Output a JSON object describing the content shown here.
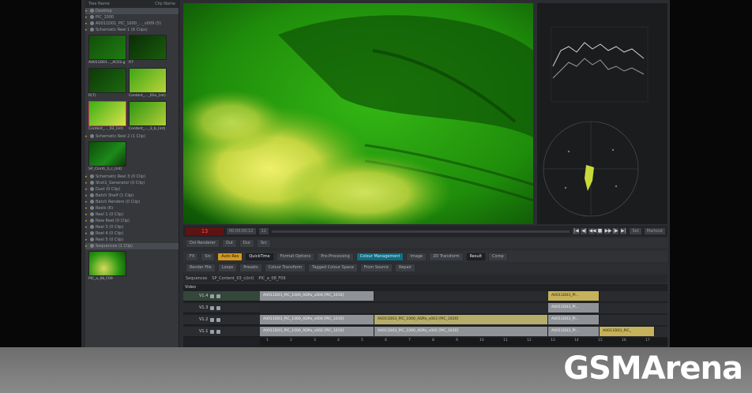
{
  "bin": {
    "header_left": "Tree Name",
    "header_right": "Clip Name",
    "rows": [
      {
        "label": "Desktop",
        "selected": true
      },
      {
        "label": "PIC_1000"
      },
      {
        "label": "A0011D01_PIC_1000_..._v009 (5)"
      },
      {
        "label": "Schematic Reel 1 (6 Clips)"
      }
    ],
    "thumbs1": [
      {
        "caption": "A0011D01..._ACES.g"
      },
      {
        "caption": "R7"
      },
      {
        "caption": "R(7)"
      },
      {
        "caption": "Content_..._01e_(int)"
      },
      {
        "caption": "Content_..._03_(int)",
        "selected": true
      },
      {
        "caption": "Content_..._3_b_(int)"
      }
    ],
    "rows2": [
      {
        "label": "Schematic Reel 2 (1 Clip)"
      }
    ],
    "thumb_single": {
      "caption": "SP_Cinnti_3_c_(int)"
    },
    "rows3": [
      {
        "label": "Schematic Reel 3 (0 Clip)"
      },
      {
        "label": "Shot1_Generator (0 Clip)"
      },
      {
        "label": "Dust (0 Clip)"
      },
      {
        "label": "Batch Shelf (1 Clip)"
      },
      {
        "label": "Batch Renders (0 Clip)"
      },
      {
        "label": "Reels (6)"
      },
      {
        "label": "Reel 1 (0 Clip)"
      },
      {
        "label": "New Reel (0 Clip)"
      },
      {
        "label": "Reel 3 (0 Clip)"
      },
      {
        "label": "Reel 4 (0 Clip)"
      },
      {
        "label": "Reel 5 (0 Clip)"
      },
      {
        "label": "Sequences (1 Clip)",
        "selected": true
      }
    ],
    "thumb_bottom": {
      "caption": "PIC_a_08_F09"
    }
  },
  "transport": {
    "timecode": "13",
    "position_label": "00:00:00:12",
    "frame_field": "12",
    "set_label": "Set",
    "mark_label": "Markout",
    "controls": [
      "|◀",
      "◀|",
      "◀◀",
      "■",
      "▶▶",
      "|▶",
      "▶|"
    ]
  },
  "bar2": {
    "items": [
      "Dst Renderer",
      "Out",
      "Dur",
      "Src"
    ]
  },
  "bar3": {
    "items": [
      {
        "label": "FX",
        "style": ""
      },
      {
        "label": "Src",
        "style": ""
      },
      {
        "label": "Auto Res",
        "style": "orange"
      },
      {
        "label": "QuickTime",
        "style": "dark"
      },
      {
        "label": "Format Options",
        "style": ""
      },
      {
        "label": "Pre-Processing",
        "style": ""
      },
      {
        "label": "Colour Management",
        "style": "teal"
      },
      {
        "label": "Image",
        "style": ""
      },
      {
        "label": "2D Transform",
        "style": ""
      },
      {
        "label": "Result",
        "style": "dark"
      },
      {
        "label": "Comp",
        "style": ""
      }
    ]
  },
  "bar4": {
    "items": [
      "Render File",
      "Loops",
      "Presets",
      "Colour Transform",
      "Tagged Colour Space",
      "From Source",
      "Repair"
    ]
  },
  "bar5": {
    "items": [
      "Sequences",
      "SP_Content_03_c(int)",
      "PIC_a_08_F09"
    ]
  },
  "timeline": {
    "section_label": "Video",
    "tracks": [
      {
        "label": "V1.4",
        "active": true
      },
      {
        "label": "V1.3"
      },
      {
        "label": "V1.2"
      },
      {
        "label": "V1.1"
      }
    ],
    "clips": [
      {
        "text": "A0011D03_PIC_1000_ADPa_v004 [PIC_1010]",
        "track": 0,
        "start": 0.0,
        "end": 0.29,
        "style": "grey"
      },
      {
        "text": "A0011D03_PI...",
        "track": 0,
        "start": 0.73,
        "end": 0.86,
        "style": "gold"
      },
      {
        "text": "A0011D03_PI...",
        "track": 1,
        "start": 0.73,
        "end": 0.86,
        "style": "grey"
      },
      {
        "text": "A0011D03_PIC_1000_ADPa_v004 [PIC_1010]",
        "track": 2,
        "start": 0.0,
        "end": 0.29,
        "style": "grey"
      },
      {
        "text": "A0011D03_PIC_1000_ADPa_v003 [PIC_1020]",
        "track": 2,
        "start": 0.29,
        "end": 0.73,
        "style": "khaki"
      },
      {
        "text": "A0011D03_PI...",
        "track": 2,
        "start": 0.73,
        "end": 0.86,
        "style": "grey"
      },
      {
        "text": "A0011D03_PIC_1000_ADPa_v002 [PIC_1010]",
        "track": 3,
        "start": 0.0,
        "end": 0.29,
        "style": "grey"
      },
      {
        "text": "A0011D03_PIC_1000_ADPa_v002 [PIC_1020]",
        "track": 3,
        "start": 0.29,
        "end": 0.73,
        "style": "grey"
      },
      {
        "text": "A0011D03_PI...",
        "track": 3,
        "start": 0.73,
        "end": 0.86,
        "style": "grey"
      },
      {
        "text": "A0011D03_PIC_",
        "track": 3,
        "start": 0.86,
        "end": 1.0,
        "style": "gold"
      }
    ],
    "ruler": [
      "1",
      "2",
      "3",
      "4",
      "5",
      "6",
      "7",
      "8",
      "9",
      "10",
      "11",
      "12",
      "13",
      "14",
      "15",
      "16",
      "17"
    ]
  },
  "watermark": "GSMArena",
  "colors": {
    "accent": "#d49a1c",
    "timecode": "#ff4a4a",
    "viewer_green": "#2c9a10"
  }
}
